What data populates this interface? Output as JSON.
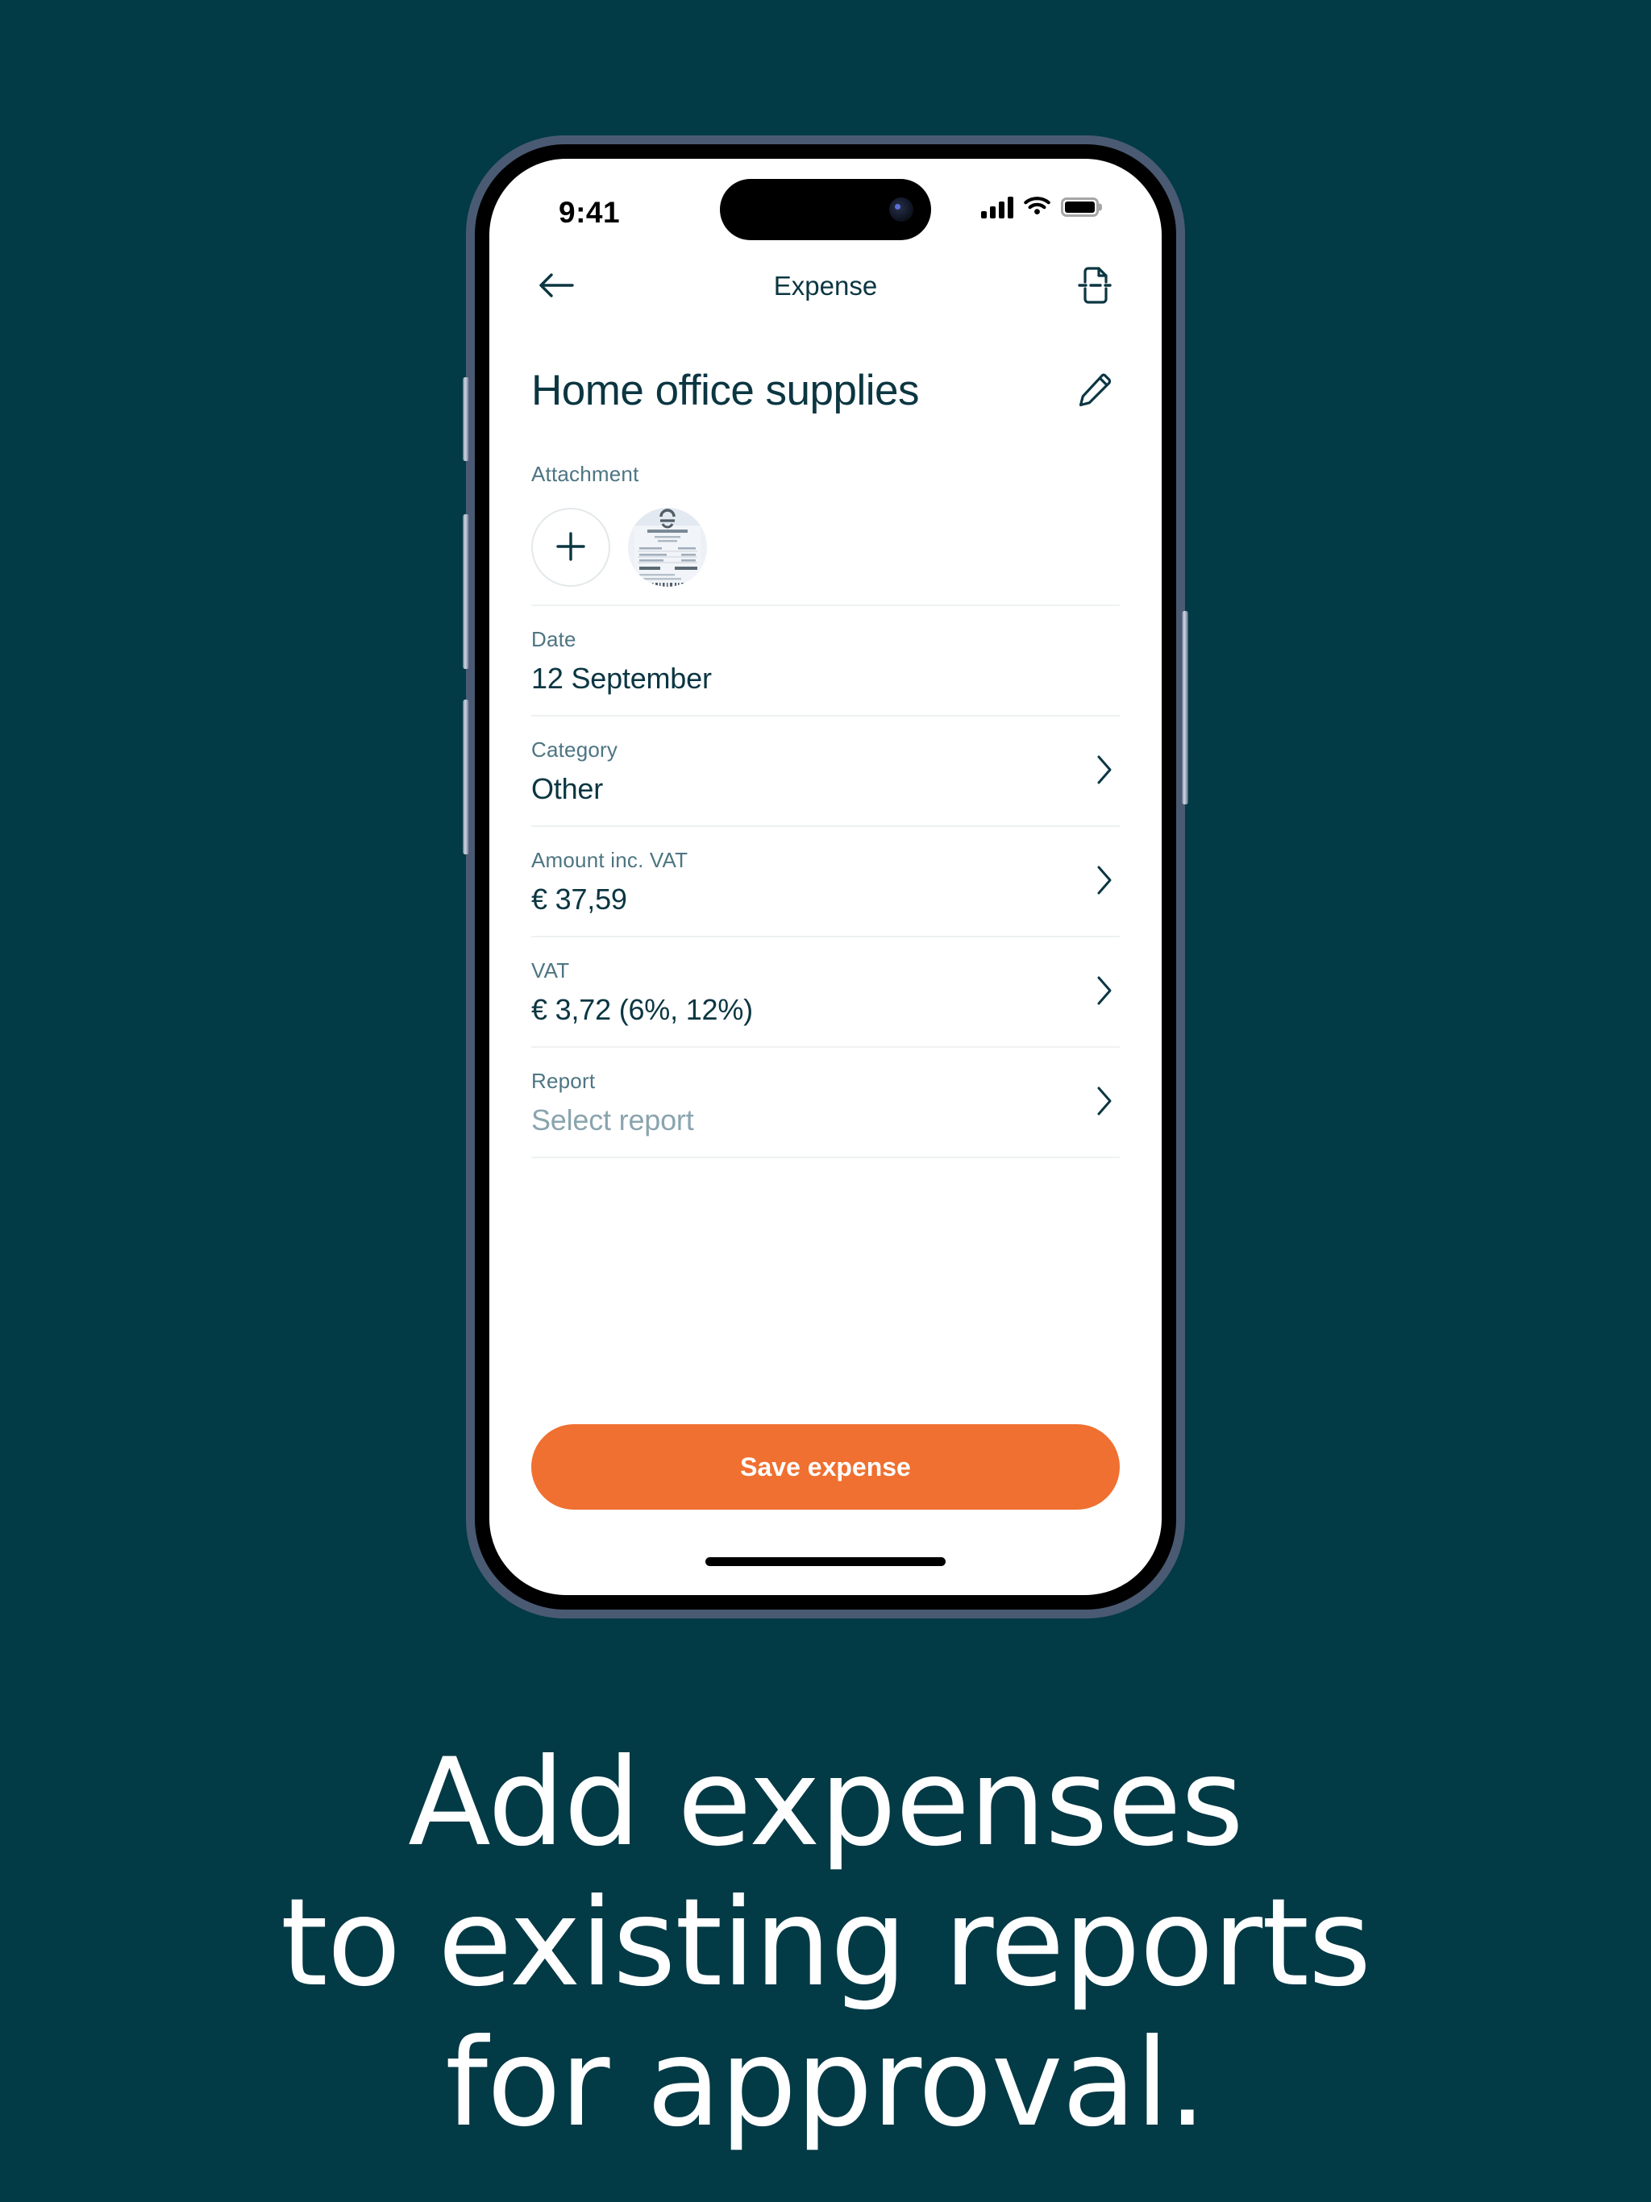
{
  "theme": {
    "background": "#023A46",
    "accent": "#EF7031",
    "ink": "#0b3642",
    "muted_label": "#4d7583",
    "placeholder": "#8aa4ae",
    "divider": "#eef1f2",
    "frame_band": "#4a5a73"
  },
  "status_bar": {
    "time": "9:41",
    "cellular_icon": "signal-bars-icon",
    "wifi_icon": "wifi-icon",
    "battery_icon": "battery-full-icon"
  },
  "nav": {
    "back_icon": "arrow-left-icon",
    "title": "Expense",
    "scan_icon": "scan-document-icon"
  },
  "expense": {
    "title": "Home office supplies",
    "edit_icon": "pencil-icon",
    "attachment": {
      "label": "Attachment",
      "add_icon": "plus-icon",
      "thumbnail_name": "receipt-thumbnail"
    },
    "fields": [
      {
        "key": "date",
        "label": "Date",
        "value": "12 September",
        "placeholder": false,
        "chevron": false
      },
      {
        "key": "category",
        "label": "Category",
        "value": "Other",
        "placeholder": false,
        "chevron": true
      },
      {
        "key": "amount",
        "label": "Amount inc. VAT",
        "value": "€ 37,59",
        "placeholder": false,
        "chevron": true
      },
      {
        "key": "vat",
        "label": "VAT",
        "value": "€ 3,72 (6%, 12%)",
        "placeholder": false,
        "chevron": true
      },
      {
        "key": "report",
        "label": "Report",
        "value": "Select report",
        "placeholder": true,
        "chevron": true
      }
    ]
  },
  "footer": {
    "save_label": "Save expense"
  },
  "caption": {
    "line1": "Add expenses",
    "line2": "to existing reports",
    "line3": "for approval."
  }
}
